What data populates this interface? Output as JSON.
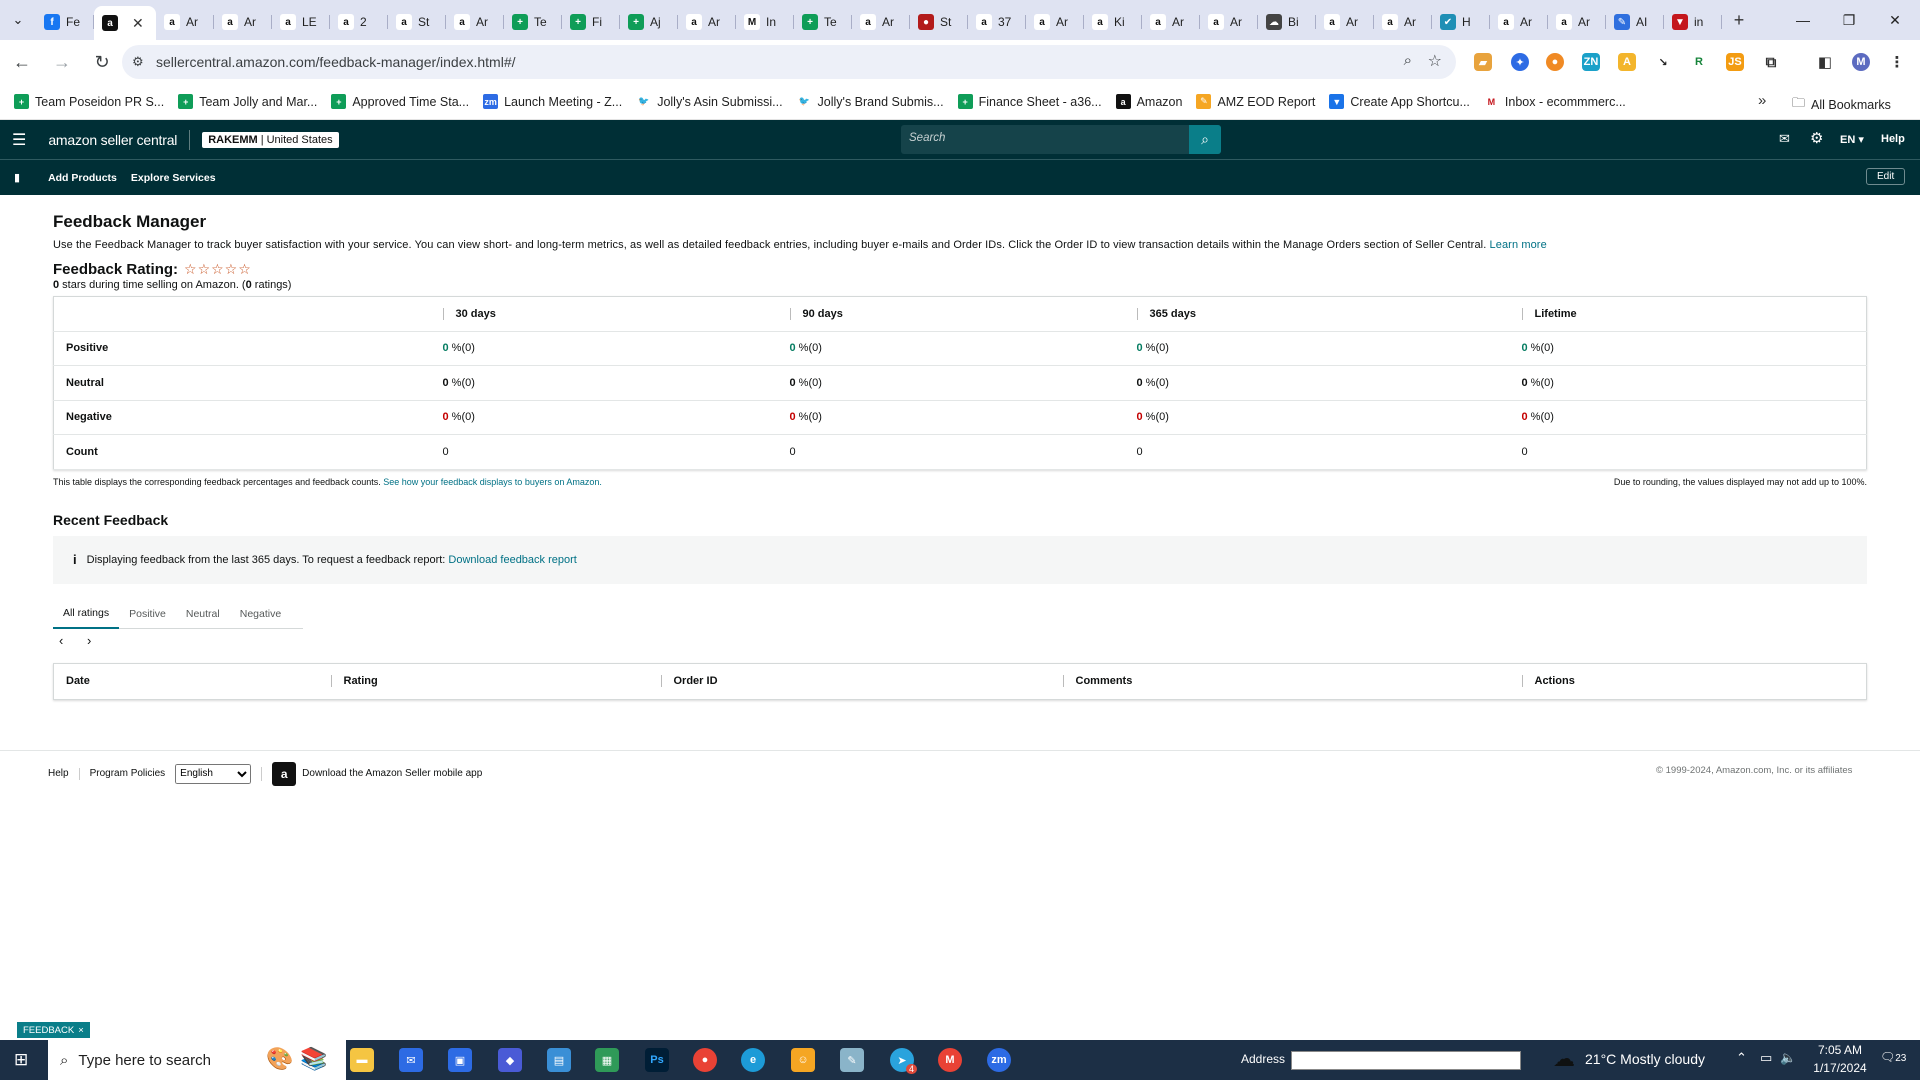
{
  "browser": {
    "tabs": [
      {
        "icon": "facebook-icon",
        "label": "Fe",
        "color": "#1877f2",
        "glyph": "f"
      },
      {
        "icon": "amazon-icon",
        "label": "",
        "color": "#111",
        "glyph": "a",
        "active": true
      },
      {
        "icon": "amazon-icon",
        "label": "Ar",
        "color": "#fff",
        "glyph": "a"
      },
      {
        "icon": "amazon-icon",
        "label": "Ar",
        "color": "#fff",
        "glyph": "a"
      },
      {
        "icon": "amazon-icon",
        "label": "LE",
        "color": "#fff",
        "glyph": "a"
      },
      {
        "icon": "amazon-icon",
        "label": "2",
        "color": "#fff",
        "glyph": "a"
      },
      {
        "icon": "amazon-icon",
        "label": "St",
        "color": "#fff",
        "glyph": "a"
      },
      {
        "icon": "amazon-icon",
        "label": "Ar",
        "color": "#fff",
        "glyph": "a"
      },
      {
        "icon": "sheets-icon",
        "label": "Te",
        "color": "#0f9d58",
        "glyph": "+"
      },
      {
        "icon": "sheets-icon",
        "label": "Fi",
        "color": "#0f9d58",
        "glyph": "+"
      },
      {
        "icon": "sheets-icon",
        "label": "Aj",
        "color": "#0f9d58",
        "glyph": "+"
      },
      {
        "icon": "amazon-icon",
        "label": "Ar",
        "color": "#fff",
        "glyph": "a"
      },
      {
        "icon": "gmail-icon",
        "label": "In",
        "color": "#fff",
        "glyph": "M"
      },
      {
        "icon": "sheets-icon",
        "label": "Te",
        "color": "#0f9d58",
        "glyph": "+"
      },
      {
        "icon": "amazon-icon",
        "label": "Ar",
        "color": "#fff",
        "glyph": "a"
      },
      {
        "icon": "extension-icon",
        "label": "St",
        "color": "#b31b1b",
        "glyph": "●"
      },
      {
        "icon": "amazon-icon",
        "label": "37",
        "color": "#fff",
        "glyph": "a"
      },
      {
        "icon": "amazon-icon",
        "label": "Ar",
        "color": "#fff",
        "glyph": "a"
      },
      {
        "icon": "amazon-icon",
        "label": "Ki",
        "color": "#fff",
        "glyph": "a"
      },
      {
        "icon": "amazon-icon",
        "label": "Ar",
        "color": "#fff",
        "glyph": "a"
      },
      {
        "icon": "amazon-icon",
        "label": "Ar",
        "color": "#fff",
        "glyph": "a"
      },
      {
        "icon": "cloud-icon",
        "label": "Bi",
        "color": "#444",
        "glyph": "☁"
      },
      {
        "icon": "amazon-icon",
        "label": "Ar",
        "color": "#fff",
        "glyph": "a"
      },
      {
        "icon": "amazon-icon",
        "label": "Ar",
        "color": "#fff",
        "glyph": "a"
      },
      {
        "icon": "helium-icon",
        "label": "H",
        "color": "#1f8fb5",
        "glyph": "✔"
      },
      {
        "icon": "amazon-icon",
        "label": "Ar",
        "color": "#fff",
        "glyph": "a"
      },
      {
        "icon": "amazon-icon",
        "label": "Ar",
        "color": "#fff",
        "glyph": "a"
      },
      {
        "icon": "pen-icon",
        "label": "AI",
        "color": "#2f6fde",
        "glyph": "✎"
      },
      {
        "icon": "shield-icon",
        "label": "in",
        "color": "#c4161c",
        "glyph": "▼"
      }
    ],
    "url": "sellercentral.amazon.com/feedback-manager/index.html#/",
    "bookmarks": [
      {
        "label": "Team Poseidon PR S...",
        "color": "#0f9d58",
        "glyph": "+"
      },
      {
        "label": "Team Jolly and Mar...",
        "color": "#0f9d58",
        "glyph": "+"
      },
      {
        "label": "Approved Time Sta...",
        "color": "#0f9d58",
        "glyph": "+"
      },
      {
        "label": "Launch Meeting - Z...",
        "color": "#2d6be4",
        "glyph": "zm"
      },
      {
        "label": "Jolly's Asin Submissi...",
        "color": "#fff",
        "glyph": "🐦"
      },
      {
        "label": "Jolly's Brand Submis...",
        "color": "#fff",
        "glyph": "🐦"
      },
      {
        "label": "Finance Sheet - a36...",
        "color": "#0f9d58",
        "glyph": "+"
      },
      {
        "label": "Amazon",
        "color": "#111",
        "glyph": "a"
      },
      {
        "label": "AMZ EOD Report",
        "color": "#f5a623",
        "glyph": "✎"
      },
      {
        "label": "Create App Shortcu...",
        "color": "#1a73e8",
        "glyph": "▼"
      },
      {
        "label": "Inbox - ecommmerc...",
        "color": "#fff",
        "glyph": "M"
      }
    ],
    "all_bookmarks": "All Bookmarks"
  },
  "seller": {
    "logo": "amazon seller central",
    "store": "RAKEMM",
    "marketplace": "United States",
    "search_placeholder": "Search",
    "lang": "EN",
    "help": "Help",
    "nav": [
      "Add Products",
      "Explore Services"
    ],
    "edit": "Edit"
  },
  "page": {
    "title": "Feedback Manager",
    "description": "Use the Feedback Manager to track buyer satisfaction with your service. You can view short- and long-term metrics, as well as detailed feedback entries, including buyer e-mails and Order IDs. Click the Order ID to view transaction details within the Manage Orders section of Seller Central.",
    "learn_more": "Learn more",
    "rating_label": "Feedback Rating:",
    "stars": "☆☆☆☆☆",
    "rating_count_bold": "0",
    "rating_sub_a": " stars during time selling on Amazon. (",
    "rating_sub_b": "0",
    "rating_sub_c": " ratings)",
    "columns": [
      "30 days",
      "90 days",
      "365 days",
      "Lifetime"
    ],
    "rows": [
      {
        "label": "Positive",
        "cls": "g",
        "values": [
          "0",
          "0",
          "0",
          "0"
        ],
        "suffix": " %(0)"
      },
      {
        "label": "Neutral",
        "cls": "",
        "values": [
          "0",
          "0",
          "0",
          "0"
        ],
        "suffix": " %(0)"
      },
      {
        "label": "Negative",
        "cls": "r",
        "values": [
          "0",
          "0",
          "0",
          "0"
        ],
        "suffix": " %(0)"
      },
      {
        "label": "Count",
        "cls": "plain",
        "values": [
          "0",
          "0",
          "0",
          "0"
        ],
        "suffix": ""
      }
    ],
    "note_left": "This table displays the corresponding feedback percentages and feedback counts.",
    "note_left_link": "See how your feedback displays to buyers on Amazon.",
    "note_right": "Due to rounding, the values displayed may not add up to 100%.",
    "recent_title": "Recent Feedback",
    "info_text": "Displaying feedback from the last 365 days. To request a feedback report:",
    "info_link": "Download feedback report",
    "filter_tabs": [
      "All ratings",
      "Positive",
      "Neutral",
      "Negative"
    ],
    "pager": "‹ ›",
    "feed_columns": [
      "Date",
      "Rating",
      "Order ID",
      "Comments",
      "Actions"
    ]
  },
  "footer": {
    "help": "Help",
    "policies": "Program Policies",
    "language": "English",
    "app": "Download the Amazon Seller mobile app",
    "copyright": "© 1999-2024, Amazon.com, Inc. or its affiliates"
  },
  "feedback_tab": "FEEDBACK",
  "taskbar": {
    "search": "Type here to search",
    "address": "Address",
    "weather": "21°C  Mostly cloudy",
    "time": "7:05 AM",
    "date": "1/17/2024",
    "notif": "23",
    "telegram_badge": "4"
  }
}
